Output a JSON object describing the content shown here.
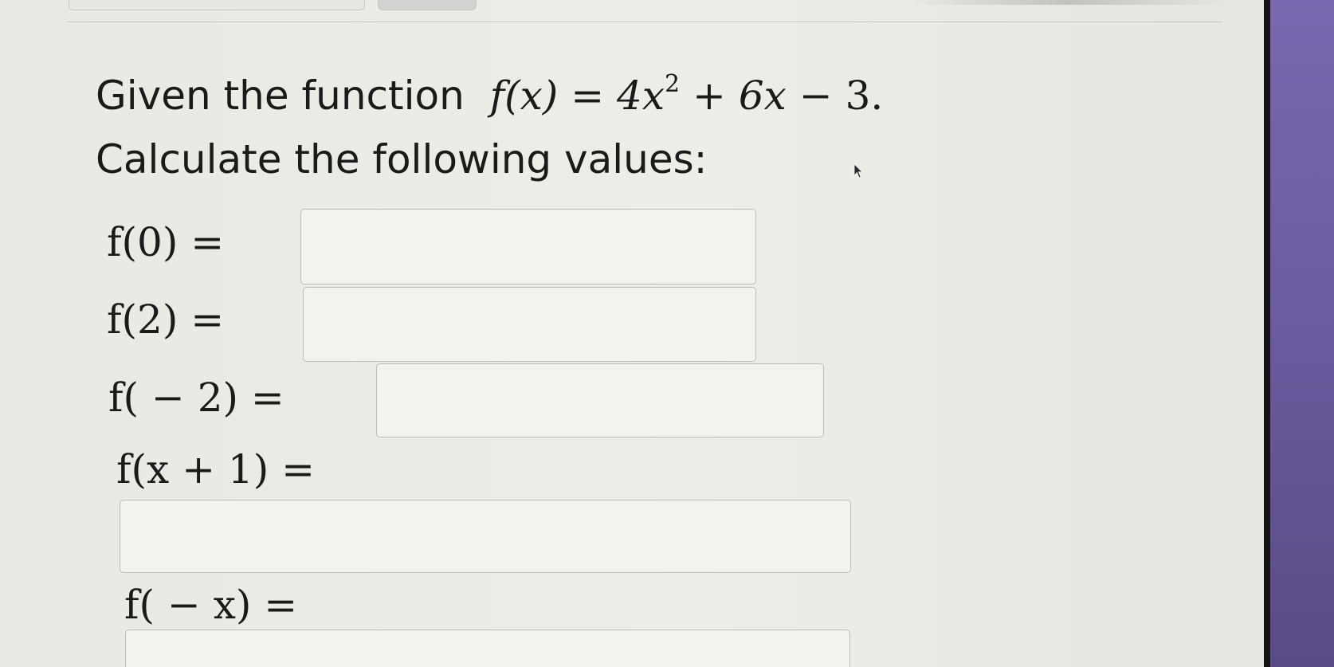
{
  "problem": {
    "intro_text": "Given the function",
    "function_lhs": "f(x)",
    "eq": "=",
    "term1": "4x",
    "exponent": "2",
    "plus": "+",
    "term2": "6x",
    "minus": "−",
    "constant": "3.",
    "instruction": "Calculate the following values:"
  },
  "questions": [
    {
      "label": "f(0) =",
      "value": ""
    },
    {
      "label": "f(2) =",
      "value": ""
    },
    {
      "label": "f( − 2) =",
      "value": ""
    },
    {
      "label": "f(x + 1) =",
      "value": ""
    },
    {
      "label": "f( − x) =",
      "value": ""
    }
  ],
  "colors": {
    "background": "#ecebe6",
    "input_border": "#bdbcb6",
    "desk_purple": "#6b5a9e"
  },
  "icons": [
    "mouse-pointer-icon"
  ]
}
